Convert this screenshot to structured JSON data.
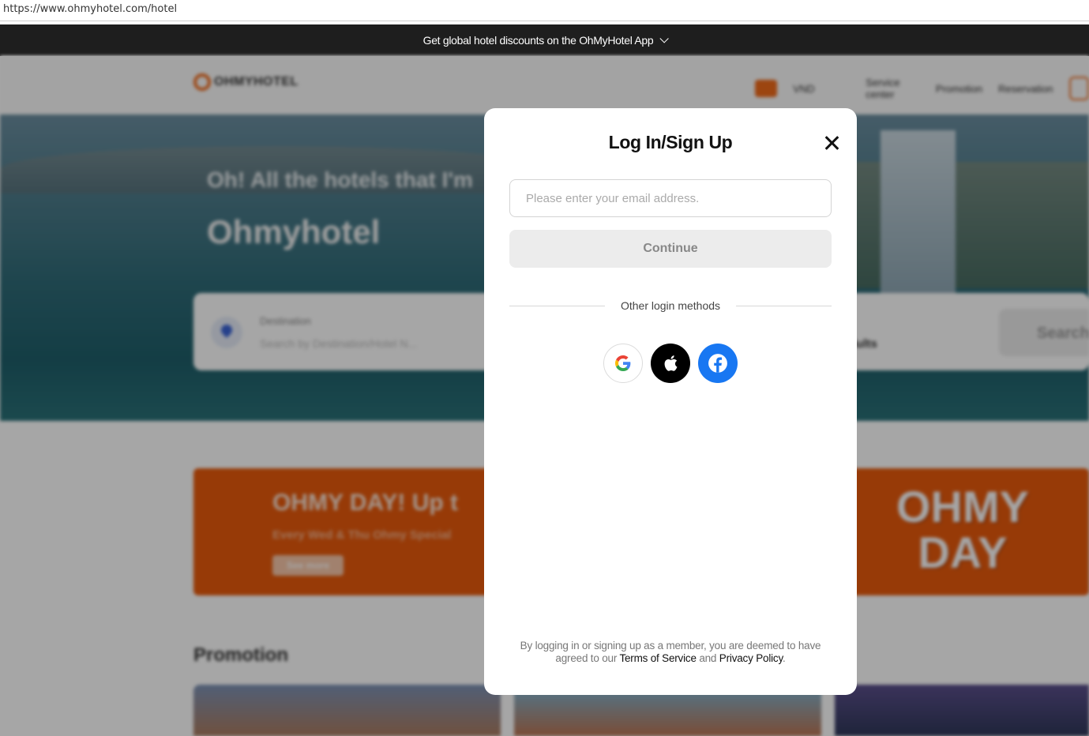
{
  "browser": {
    "url": "https://www.ohmyhotel.com/hotel"
  },
  "top_banner": {
    "text": "Get global hotel discounts on the OhMyHotel App"
  },
  "header": {
    "logo": "OHMYHOTEL",
    "currency": "VND",
    "nav": [
      "Service center",
      "Promotion",
      "Reservation"
    ]
  },
  "hero": {
    "tagline": "Oh! All the hotels that I'm",
    "title": "Ohmyhotel"
  },
  "search": {
    "destination_label": "Destination",
    "destination_placeholder": "Search by Destination/Hotel N...",
    "guests_value": "dults",
    "search_label": "Search"
  },
  "promo_banner": {
    "title": "OHMY DAY! Up t",
    "subtitle": "Every Wed & Thu Ohmy Special",
    "button": "See more",
    "art_text": "OHMY DAY"
  },
  "promotion_section": {
    "title": "Promotion"
  },
  "modal": {
    "title": "Log In/Sign Up",
    "email_placeholder": "Please enter your email address.",
    "continue_label": "Continue",
    "divider_text": "Other login methods",
    "terms_prefix": "By logging in or signing up as a member, you are deemed to have agreed to our ",
    "terms_link": "Terms of Service",
    "terms_and": " and ",
    "privacy_link": "Privacy Policy",
    "terms_suffix": ".",
    "social_icons": [
      "google-icon",
      "apple-icon",
      "facebook-icon"
    ]
  },
  "colors": {
    "brand_orange": "#e85a0c",
    "facebook_blue": "#1877f2",
    "banner_dark": "#1e1e1e"
  }
}
